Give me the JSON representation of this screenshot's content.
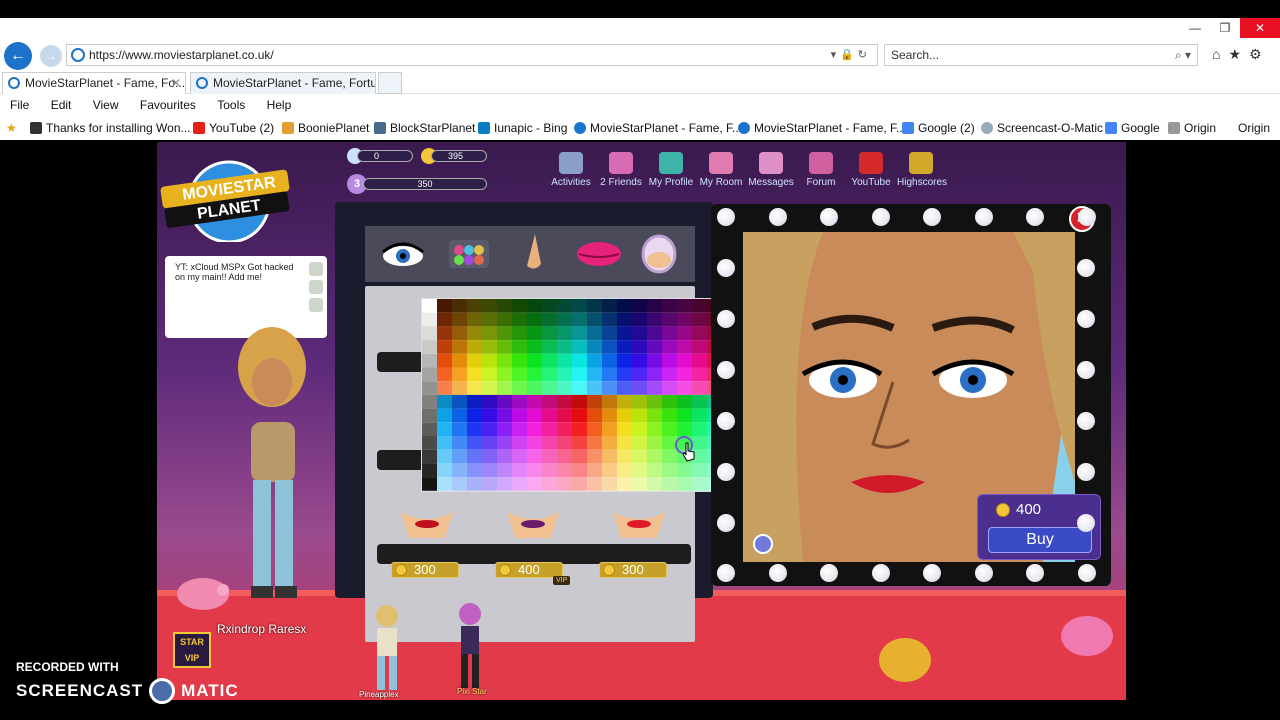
{
  "browser": {
    "url": "https://www.moviestarplanet.co.uk/",
    "search_placeholder": "Search...",
    "tabs": [
      {
        "label": "MovieStarPlanet - Fame, Fo..."
      },
      {
        "label": "MovieStarPlanet - Fame, Fortu..."
      }
    ],
    "menu": [
      "File",
      "Edit",
      "View",
      "Favourites",
      "Tools",
      "Help"
    ],
    "favourites": [
      "Thanks for installing Won...",
      "YouTube (2)",
      "BooniePlanet",
      "BlockStarPlanet",
      "Iunapic - Bing",
      "MovieStarPlanet - Fame, F...",
      "MovieStarPlanet - Fame, F...",
      "Google (2)",
      "Screencast-O-Matic",
      "Google",
      "Origin",
      "Origin"
    ]
  },
  "game": {
    "hud": {
      "diamonds": "0",
      "coins": "395",
      "level": "3",
      "fame": "350"
    },
    "nav": [
      "Activities",
      "2 Friends",
      "My Profile",
      "My Room",
      "Messages",
      "Forum",
      "YouTube",
      "Highscores"
    ],
    "chat_text": "YT: xCloud MSPx Got hacked on my main!! Add me!",
    "prices": [
      "300",
      "400",
      "300"
    ],
    "vip_label": "VIP",
    "buy": {
      "amount": "400",
      "label": "Buy"
    },
    "players": {
      "main": "Rxindrop Raresx",
      "other1": "Pineapplex",
      "other2": "Pixi Star"
    },
    "colors": {
      "accent": "#4b2f8e",
      "close": "#d2232a",
      "coin": "#f3c73a"
    }
  },
  "watermark": {
    "recorded": "RECORDED WITH",
    "brand_left": "SCREENCAST",
    "brand_right": "MATIC"
  }
}
